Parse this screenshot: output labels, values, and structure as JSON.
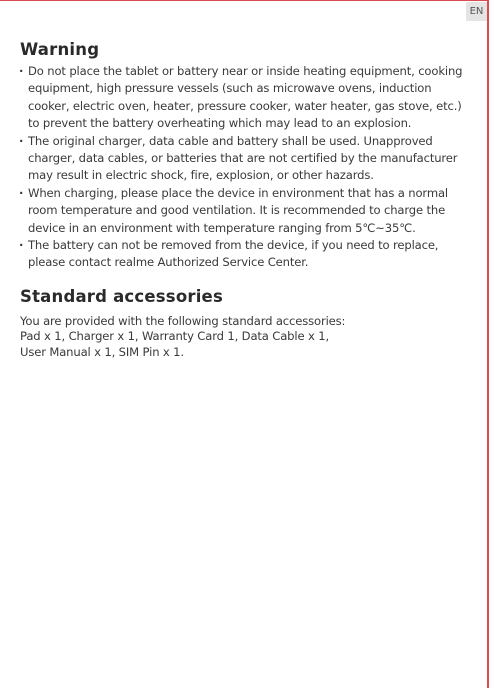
{
  "lang_tab": "EN",
  "warning": {
    "heading": "Warning",
    "items": [
      "Do not place the tablet or battery near or inside heating equipment, cooking equipment, high pressure vessels (such as microwave ovens, induction cooker, electric oven, heater, pressure cooker, water heater, gas stove, etc.) to prevent the battery overheating which may lead to an explosion.",
      "The original charger, data cable and battery shall be used. Unapproved charger, data cables, or batteries that are not certified by the manufacturer may result in electric shock, fire, explosion, or other hazards.",
      "When charging, please place the device in environment that has a normal room temperature and good ventilation. It is recommended to charge the device in an environment with temperature ranging from 5℃~35℃.",
      "The battery can not be removed from the device, if you need to replace, please contact realme Authorized Service Center."
    ]
  },
  "accessories": {
    "heading": "Standard accessories",
    "text": "You are provided with the following standard accessories:\nPad x 1,  Charger x 1,  Warranty Card 1,  Data Cable x 1,\nUser Manual x 1,  SIM Pin x 1."
  }
}
